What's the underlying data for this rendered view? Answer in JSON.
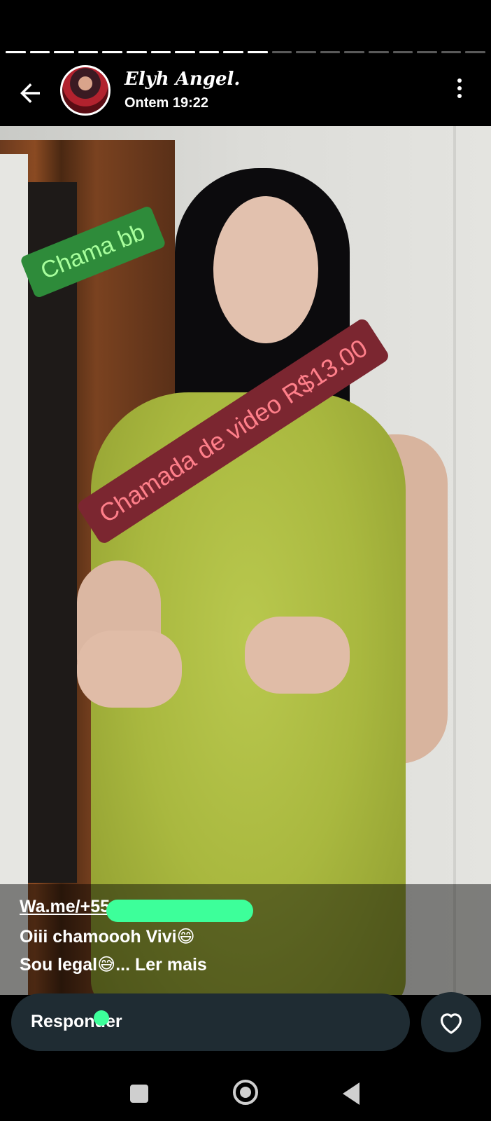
{
  "status": {
    "viewed_segments": 11,
    "total_segments": 20
  },
  "header": {
    "name": "Elyh Angel.",
    "time": "Ontem 19:22",
    "back_icon": "arrow-left-icon",
    "menu_icon": "more-vertical-icon"
  },
  "media": {
    "overlay_text_1": "Chama bb",
    "overlay_text_2": "Chamada de video R$13.00",
    "overlay_color_1": "#2e8b3a",
    "overlay_color_2": "#7b2630"
  },
  "caption": {
    "link": "Wa.me/+55",
    "line2": "Oiii chamoooh Vivi😄",
    "line3_text": "Sou legal😅",
    "read_more": "... Ler mais"
  },
  "reply": {
    "placeholder": "Responder",
    "heart_icon": "heart-icon"
  },
  "nav": {
    "recent_icon": "recent-apps-icon",
    "home_icon": "home-icon",
    "back_icon": "back-triangle-icon"
  }
}
